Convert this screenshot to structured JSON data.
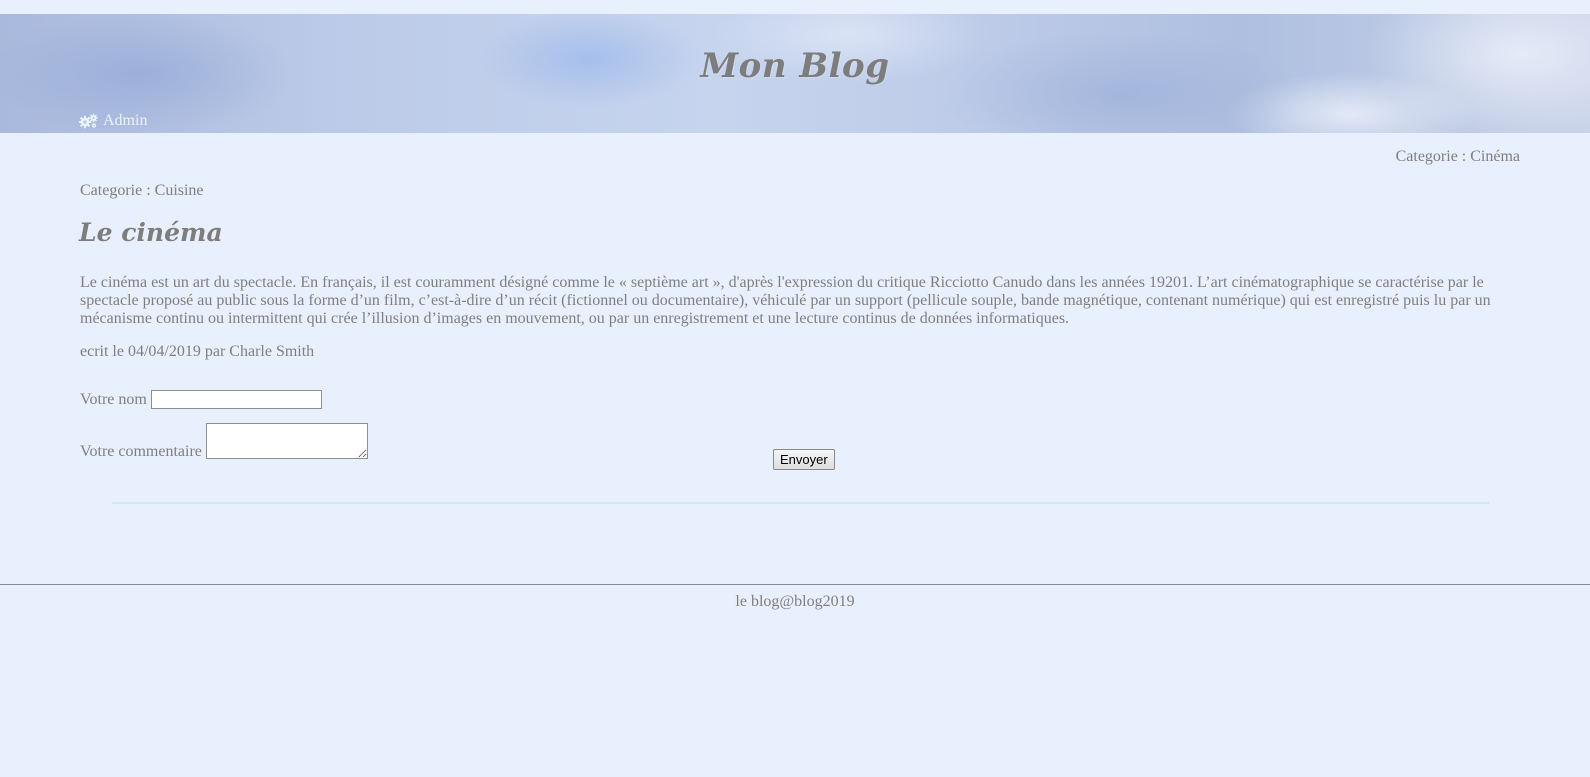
{
  "header": {
    "site_title": "Mon Blog",
    "admin_label": "Admin",
    "admin_icon": "gears-icon"
  },
  "categories": {
    "right_label": "Categorie : Cinéma",
    "left_label": "Categorie : Cuisine"
  },
  "post": {
    "title": "Le cinéma",
    "body": "Le cinéma est un art du spectacle. En français, il est couramment désigné comme le « septième art », d'après l'expression du critique Ricciotto Canudo dans les années 19201. L’art cinématographique se caractérise par le spectacle proposé au public sous la forme d’un film, c’est-à-dire d’un récit (fictionnel ou documentaire), véhiculé par un support (pellicule souple, bande magnétique, contenant numérique) qui est enregistré puis lu par un mécanisme continu ou intermittent qui crée l’illusion d’images en mouvement, ou par un enregistrement et une lecture continus de données informatiques.",
    "meta": "ecrit le 04/04/2019 par Charle Smith"
  },
  "comment_form": {
    "name_label": "Votre nom",
    "name_value": "",
    "comment_label": "Votre commentaire",
    "comment_value": "",
    "submit_label": "Envoyer"
  },
  "footer": {
    "text": "le blog@blog2019"
  },
  "colors": {
    "background": "#e8effd",
    "text": "#7f7f7f",
    "admin_link": "#e9f4ff",
    "divider": "#cfe6f5"
  }
}
